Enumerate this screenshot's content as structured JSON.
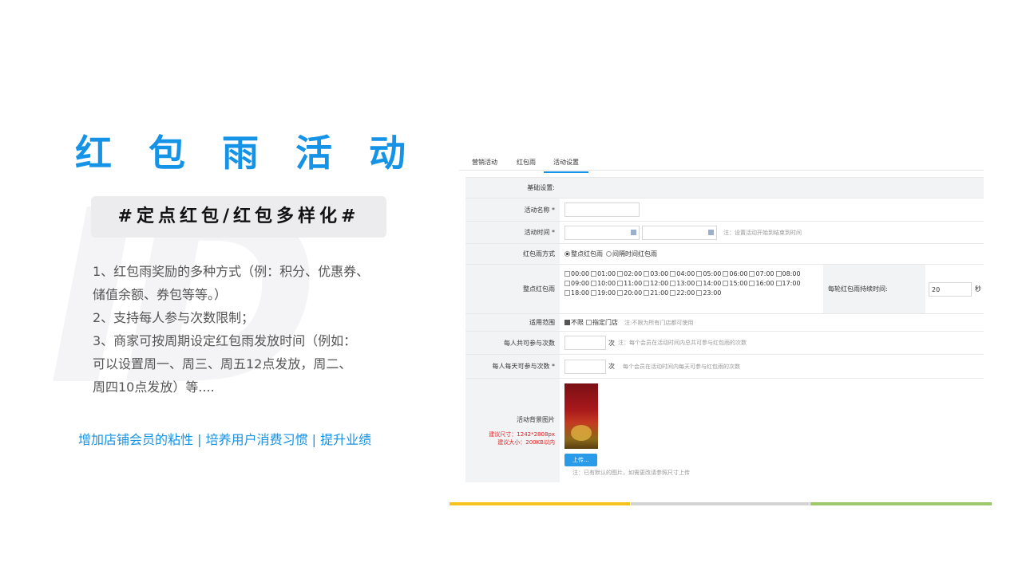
{
  "watermark_text": "ID",
  "title": "红包雨活动",
  "tagline": "#定点红包/红包多样化#",
  "description": [
    "1、红包雨奖励的多种方式（例：积分、优惠券、",
    "储值余额、券包等等。）",
    "2、支持每人参与次数限制；",
    "3、商家可按周期设定红包雨发放时间（例如：",
    "可以设置周一、周三、周五12点发放，周二、",
    "周四10点发放）等...."
  ],
  "bottom_line": "增加店铺会员的粘性 |   培养用户消费习惯 | 提升业绩",
  "screenshot": {
    "tabs": [
      "营销活动",
      "红包雨",
      "活动设置"
    ],
    "active_tab": "活动设置",
    "section_title": "基础设置:",
    "rows": {
      "name_label": "活动名称 *",
      "time_label": "活动时间 *",
      "time_note": "注：设置活动开始到结束到时间",
      "mode_label": "红包雨方式",
      "mode_options": [
        "整点红包雨",
        "间隔时间红包雨"
      ],
      "mode_selected": "整点红包雨",
      "hourly_label": "整点红包雨",
      "hours": [
        "00:00",
        "01:00",
        "02:00",
        "03:00",
        "04:00",
        "05:00",
        "06:00",
        "07:00",
        "08:00",
        "09:00",
        "10:00",
        "11:00",
        "12:00",
        "13:00",
        "14:00",
        "15:00",
        "16:00",
        "17:00",
        "18:00",
        "19:00",
        "20:00",
        "21:00",
        "22:00",
        "23:00"
      ],
      "duration_label": "每轮红包雨持续时间:",
      "duration_value": "20",
      "duration_unit": "秒",
      "scope_label": "适用范围",
      "scope_options": [
        "不限",
        "指定门店"
      ],
      "scope_note": "注:不限为所有门店都可使用",
      "total_label": "每人共可参与次数",
      "total_unit": "次",
      "total_note": "注：每个会员在活动时间内总共可参与红包雨的次数",
      "daily_label": "每人每天可参与次数 *",
      "daily_unit": "次",
      "daily_note": "每个会员在活动时间内每天可参与红包雨的次数",
      "bg_label": "活动背景图片",
      "bg_size": "建议尺寸：1242*2808px",
      "bg_filesize": "建议大小：200KB以内",
      "upload_label": "上传...",
      "upload_note": "注：已有默认的图片，如需更改请参照尺寸上传"
    }
  },
  "colors": {
    "accent": "#1593e6",
    "bar_yellow": "#f7c21c",
    "bar_gray": "#d4d4d4",
    "bar_green": "#9cca6a",
    "required_red": "#e02020"
  }
}
